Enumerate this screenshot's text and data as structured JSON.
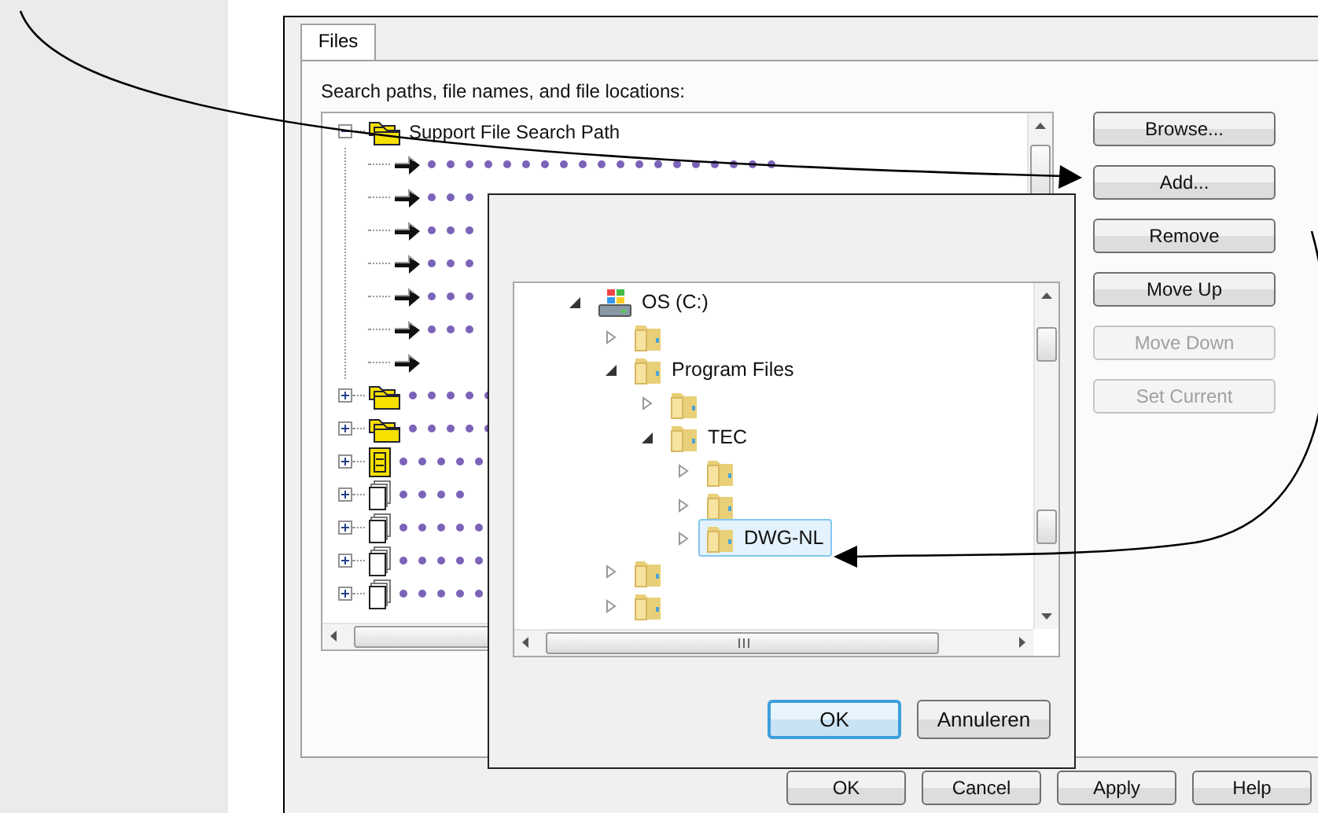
{
  "options_dialog": {
    "tabs": [
      {
        "label": "Files",
        "selected": true
      }
    ],
    "list_label": "Search paths, file names, and file locations:",
    "tree": [
      {
        "label": "Support File Search Path",
        "kind": "folders",
        "expanded": true,
        "children": [
          {
            "kind": "arrow",
            "redacted": true
          },
          {
            "kind": "arrow",
            "redacted": true
          },
          {
            "kind": "arrow",
            "redacted": true
          },
          {
            "kind": "arrow",
            "redacted": true
          },
          {
            "kind": "arrow",
            "redacted": true
          },
          {
            "kind": "arrow",
            "redacted": true
          },
          {
            "kind": "arrow",
            "redacted": false
          }
        ]
      },
      {
        "kind": "folders",
        "expanded": false,
        "redacted": true
      },
      {
        "kind": "folders",
        "expanded": false,
        "redacted": true
      },
      {
        "kind": "book",
        "expanded": false,
        "redacted": true
      },
      {
        "kind": "pages",
        "expanded": false,
        "redacted": true
      },
      {
        "kind": "pages",
        "expanded": false,
        "redacted": true
      },
      {
        "kind": "pages",
        "expanded": false,
        "redacted": true
      },
      {
        "kind": "pages",
        "expanded": false,
        "redacted": true
      }
    ],
    "side_buttons": [
      {
        "label": "Browse...",
        "disabled": false
      },
      {
        "label": "Add...",
        "disabled": false
      },
      {
        "label": "Remove",
        "disabled": false
      },
      {
        "label": "Move Up",
        "disabled": false
      },
      {
        "label": "Move Down",
        "disabled": true
      },
      {
        "label": "Set Current",
        "disabled": true
      }
    ],
    "footer_buttons": [
      {
        "label": "OK"
      },
      {
        "label": "Cancel"
      },
      {
        "label": "Apply"
      },
      {
        "label": "Help"
      }
    ]
  },
  "folder_dialog": {
    "tree": [
      {
        "label": "OS (C:)",
        "kind": "drive",
        "expanded": true,
        "selected": false,
        "children": [
          {
            "kind": "folder",
            "expanded": false,
            "selected": false
          },
          {
            "label": "Program Files",
            "kind": "folder",
            "expanded": true,
            "selected": false,
            "children": [
              {
                "kind": "folder",
                "expanded": false,
                "selected": false
              },
              {
                "label": "TEC",
                "kind": "folder",
                "expanded": true,
                "selected": false,
                "children": [
                  {
                    "kind": "folder",
                    "expanded": false,
                    "selected": false
                  },
                  {
                    "kind": "folder",
                    "expanded": false,
                    "selected": false
                  },
                  {
                    "label": "DWG-NL",
                    "kind": "folder",
                    "expanded": false,
                    "selected": true
                  }
                ]
              }
            ]
          },
          {
            "kind": "folder",
            "expanded": false,
            "selected": false
          },
          {
            "kind": "folder",
            "expanded": false,
            "selected": false
          }
        ]
      }
    ],
    "buttons": [
      {
        "label": "OK",
        "focused": true
      },
      {
        "label": "Annuleren",
        "focused": false
      }
    ]
  },
  "callouts": [
    {
      "kind": "curved-arrow"
    },
    {
      "kind": "curved-arrow"
    }
  ]
}
